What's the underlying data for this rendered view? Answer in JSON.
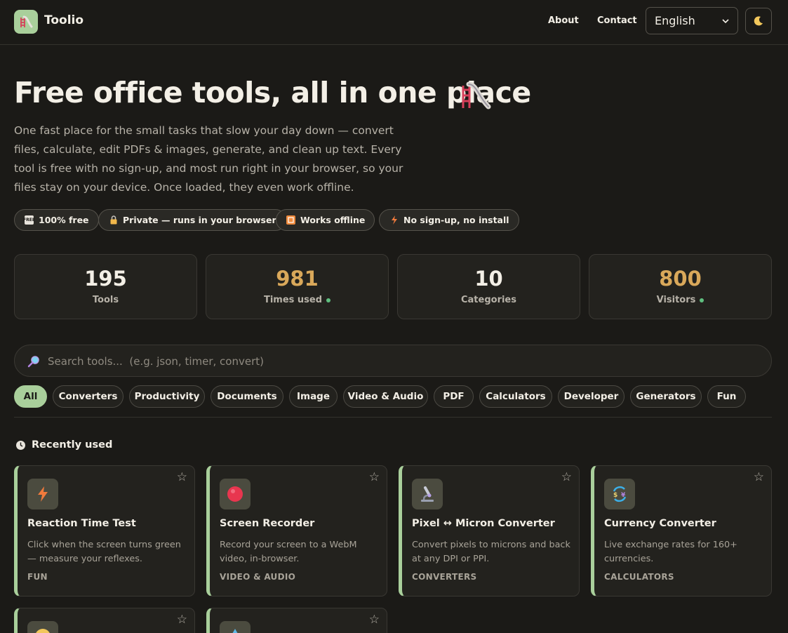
{
  "header": {
    "brand": "Toolio",
    "nav": [
      {
        "label": "About"
      },
      {
        "label": "Contact"
      }
    ],
    "language": "English",
    "logo_icon": "slide-icon",
    "theme_icon": "moon-icon"
  },
  "hero": {
    "title": "Free office tools, all in one place",
    "title_icon": "slide-icon",
    "description": "One fast place for the small tasks that slow your day down — convert files, calculate, edit PDFs & images, generate, and clean up text. Every tool is free with no sign-up, and most run right in your browser, so your files stay on your device. Once loaded, they even work offline."
  },
  "badges": [
    {
      "label": "100% free",
      "icon": "free-icon"
    },
    {
      "label": "Private — runs in your browser",
      "icon": "lock-icon"
    },
    {
      "label": "Works offline",
      "icon": "offline-icon"
    },
    {
      "label": "No sign-up, no install",
      "icon": "lightning-icon"
    }
  ],
  "stats": [
    {
      "value": "195",
      "label": "Tools",
      "live": false
    },
    {
      "value": "981",
      "label": "Times used",
      "live": true
    },
    {
      "value": "10",
      "label": "Categories",
      "live": false
    },
    {
      "value": "800",
      "label": "Visitors",
      "live": true
    }
  ],
  "search": {
    "placeholder": "Search tools...  (e.g. json, timer, convert)",
    "value": ""
  },
  "categories": [
    {
      "label": "All",
      "active": true
    },
    {
      "label": "Converters"
    },
    {
      "label": "Productivity"
    },
    {
      "label": "Documents"
    },
    {
      "label": "Image"
    },
    {
      "label": "Video & Audio"
    },
    {
      "label": "PDF"
    },
    {
      "label": "Calculators"
    },
    {
      "label": "Developer"
    },
    {
      "label": "Generators"
    },
    {
      "label": "Fun"
    }
  ],
  "recent": {
    "heading": "Recently used",
    "icon": "clock-icon",
    "tools": [
      {
        "title": "Reaction Time Test",
        "description": "Click when the screen turns green — measure your reflexes.",
        "category": "FUN",
        "icon": "lightning-icon"
      },
      {
        "title": "Screen Recorder",
        "description": "Record your screen to a WebM video, in-browser.",
        "category": "VIDEO & AUDIO",
        "icon": "record-icon"
      },
      {
        "title": "Pixel ↔ Micron Converter",
        "description": "Convert pixels to microns and back at any DPI or PPI.",
        "category": "CONVERTERS",
        "icon": "microscope-icon"
      },
      {
        "title": "Currency Converter",
        "description": "Live exchange rates for 160+ currencies.",
        "category": "CALCULATORS",
        "icon": "currency-exchange-icon"
      }
    ]
  },
  "colors": {
    "accent": "#a9cf9b",
    "highlight_number": "#d9a85a",
    "background": "#1b1a17",
    "card": "#23221e"
  }
}
